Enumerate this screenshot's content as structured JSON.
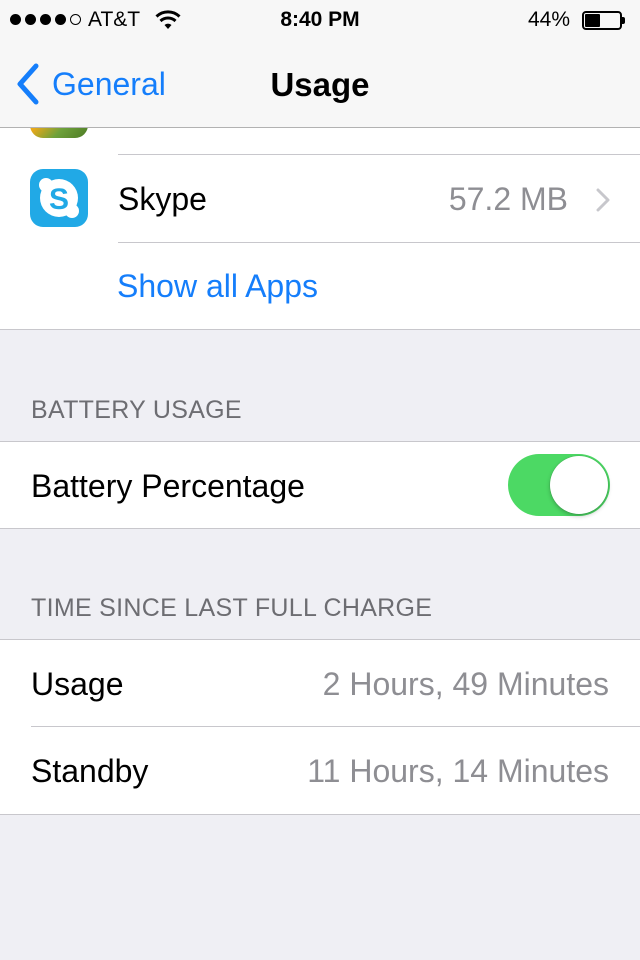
{
  "status_bar": {
    "carrier": "AT&T",
    "time": "8:40 PM",
    "battery_percent_text": "44%",
    "battery_level": 0.44,
    "signal_bars_filled": 4,
    "signal_bars_total": 5
  },
  "nav": {
    "back_label": "General",
    "title": "Usage",
    "accent_color": "#157efb"
  },
  "apps": {
    "partial_app_icon": "game-app-icon",
    "items": [
      {
        "name": "Skype",
        "size": "57.2 MB",
        "icon": "skype-icon"
      }
    ],
    "show_all_label": "Show all Apps"
  },
  "battery_usage": {
    "header": "BATTERY USAGE",
    "battery_percentage_label": "Battery Percentage",
    "battery_percentage_on": true,
    "toggle_on_color": "#4cd964"
  },
  "time_since_charge": {
    "header": "TIME SINCE LAST FULL CHARGE",
    "rows": [
      {
        "label": "Usage",
        "value": "2 Hours, 49 Minutes"
      },
      {
        "label": "Standby",
        "value": "11 Hours, 14 Minutes"
      }
    ]
  }
}
